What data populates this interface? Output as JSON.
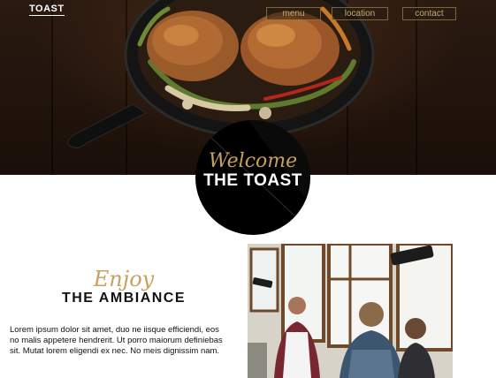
{
  "brand": {
    "logo_text": "TOAST"
  },
  "nav": {
    "items": [
      "menu",
      "location",
      "contact"
    ]
  },
  "hero": {
    "image": "roast-chicken-skillet-photo"
  },
  "badge": {
    "welcome": "Welcome",
    "title": "THE TOAST"
  },
  "section": {
    "heading_script": "Enjoy",
    "heading": "THE AMBIANCE",
    "body": "Lorem ipsum dolor sit amet, duo ne iisque efficiendi, eos no malis appetere hendrerit. Ut porro maiorum definiebas sit. Mutat lorem eligendi ex nec. No meis dignissim nam.",
    "image": "restaurant-interior-photo"
  },
  "colors": {
    "gold": "#c6a15e",
    "dark": "#1a0f09",
    "black": "#000000"
  }
}
